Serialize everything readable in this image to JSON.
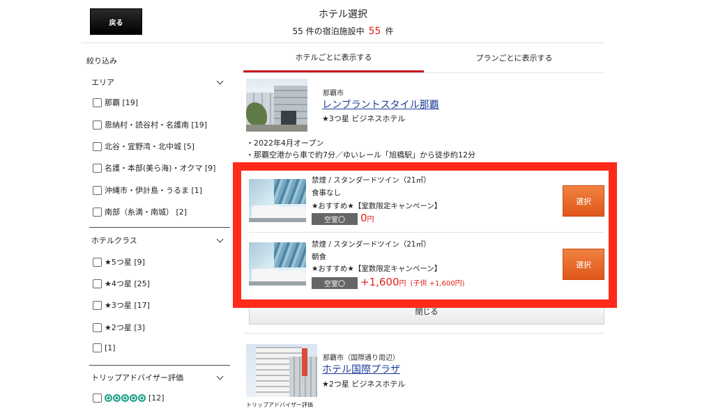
{
  "header": {
    "back_label": "戻る",
    "title": "ホテル選択",
    "count_prefix": "55 件の宿泊施設中",
    "count_value": "55",
    "count_suffix": "件"
  },
  "sidebar": {
    "title": "絞り込み",
    "area": {
      "label": "エリア",
      "items": [
        "那覇 [19]",
        "恩納村・読谷村・名護南 [19]",
        "北谷・宜野湾・北中城 [5]",
        "名護・本部(美ら海)・オクマ [9]",
        "沖縄市・伊計島・うるま [1]",
        "南部（糸満・南城） [2]"
      ]
    },
    "hotel_class": {
      "label": "ホテルクラス",
      "items": [
        "★5つ星 [9]",
        "★4つ星 [25]",
        "★3つ星 [17]",
        "★2つ星 [3]",
        " [1]"
      ]
    },
    "tripadvisor": {
      "label": "トリップアドバイザー評価",
      "items": [
        "[12]"
      ]
    }
  },
  "tabs": {
    "by_hotel": "ホテルごとに表示する",
    "by_plan": "プランごとに表示する"
  },
  "hotels": [
    {
      "area": "那覇市",
      "name": "レンブラントスタイル那覇",
      "class": "★3つ星 ビジネスホテル",
      "bullets": [
        "・2022年4月オープン",
        "・那覇空港から車で約7分／ゆいレール「旭橋駅」から徒歩約12分"
      ],
      "plans": [
        {
          "room": "禁煙 / スタンダードツイン（21㎡）",
          "meal": "食事なし",
          "campaign": "★おすすめ★【室数限定キャンペーン】",
          "vacancy": "空室〇",
          "price": "0",
          "yen": "円",
          "child": "",
          "select_label": "選択"
        },
        {
          "room": "禁煙 / スタンダードツイン（21㎡）",
          "meal": "朝食",
          "campaign": "★おすすめ★【室数限定キャンペーン】",
          "vacancy": "空室〇",
          "price": "+1,600",
          "yen": "円",
          "child": "(子供 +1,600円)",
          "select_label": "選択"
        }
      ],
      "close_label": "閉じる"
    },
    {
      "area": "那覇市（国際通り周辺）",
      "name": "ホテル国際プラザ",
      "class": "★2つ星 ビジネスホテル",
      "tripadvisor_label": "トリップアドバイザー評価"
    }
  ],
  "colors": {
    "accent_red": "#e0201c",
    "tab_underline": "#c8181e",
    "highlight_border": "#ff2a1a",
    "select_orange": "#e0561a",
    "link_blue": "#1a3c9a",
    "tripadvisor_green": "#1da086"
  }
}
